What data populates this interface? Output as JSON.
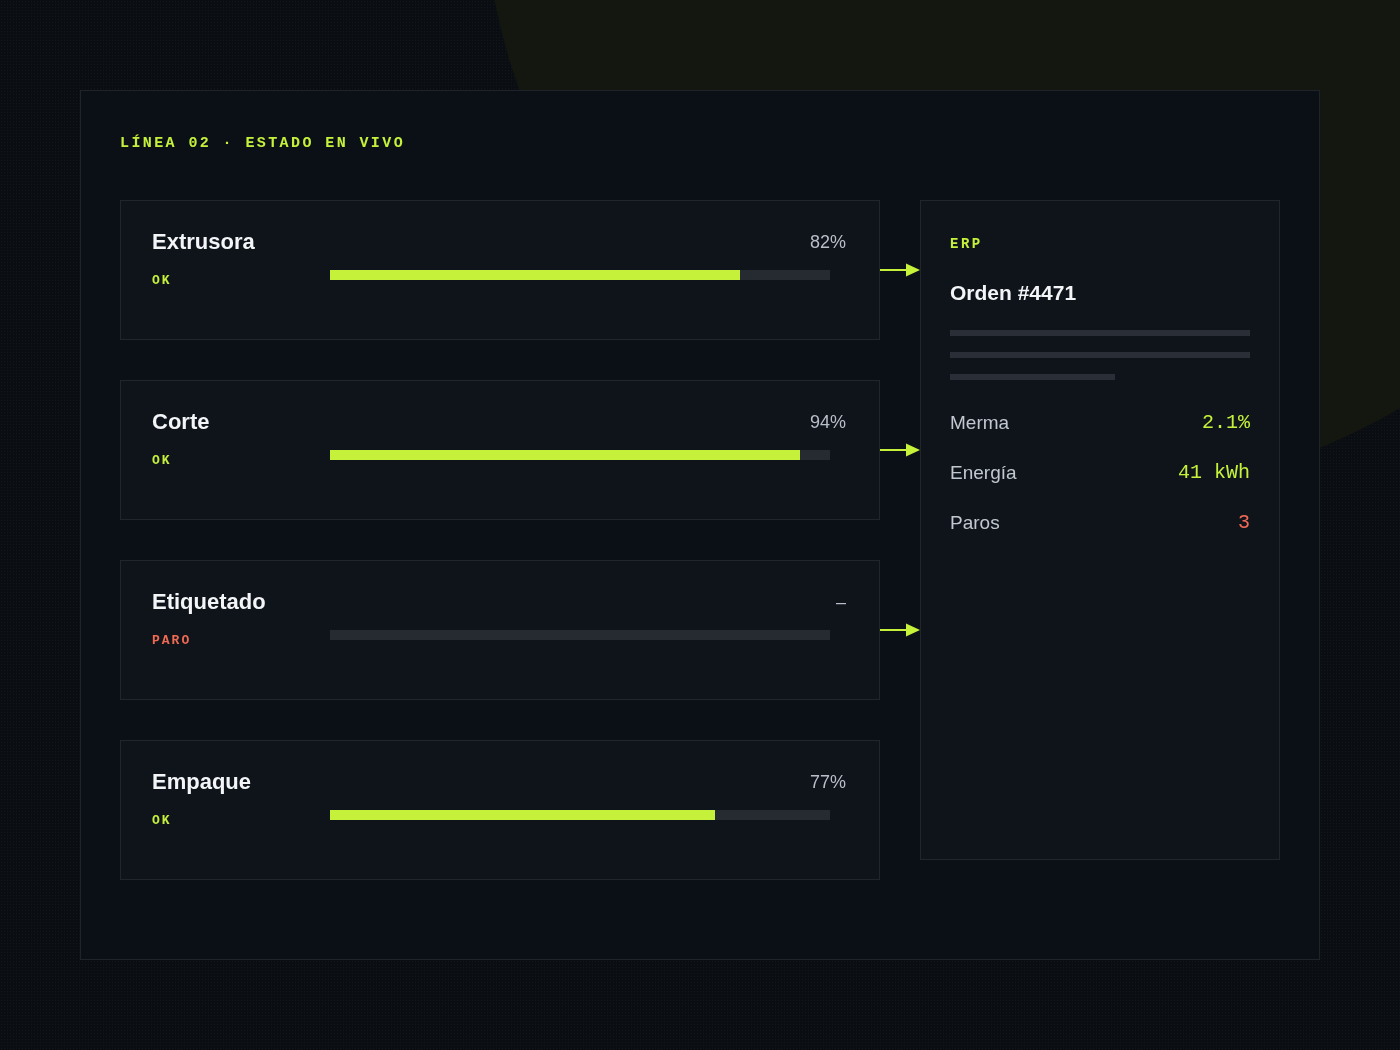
{
  "header": {
    "title": "LÍNEA 02 · ESTADO EN VIVO"
  },
  "stations": [
    {
      "name": "Extrusora",
      "status": "OK",
      "stopped": false,
      "reading": "82%",
      "level": 0.82,
      "connected": true
    },
    {
      "name": "Corte",
      "status": "OK",
      "stopped": false,
      "reading": "94%",
      "level": 0.94,
      "connected": true
    },
    {
      "name": "Etiquetado",
      "status": "PARO",
      "stopped": true,
      "reading": "–",
      "connected": true
    },
    {
      "name": "Empaque",
      "status": "OK",
      "stopped": false,
      "reading": "77%",
      "level": 0.77,
      "connected": false
    }
  ],
  "erp": {
    "label": "ERP",
    "title": "Orden #4471",
    "metrics": [
      {
        "label": "Merma",
        "value": "2.1%",
        "alert": false
      },
      {
        "label": "Energía",
        "value": "41 kWh",
        "alert": false
      },
      {
        "label": "Paros",
        "value": "3",
        "alert": true
      }
    ]
  }
}
